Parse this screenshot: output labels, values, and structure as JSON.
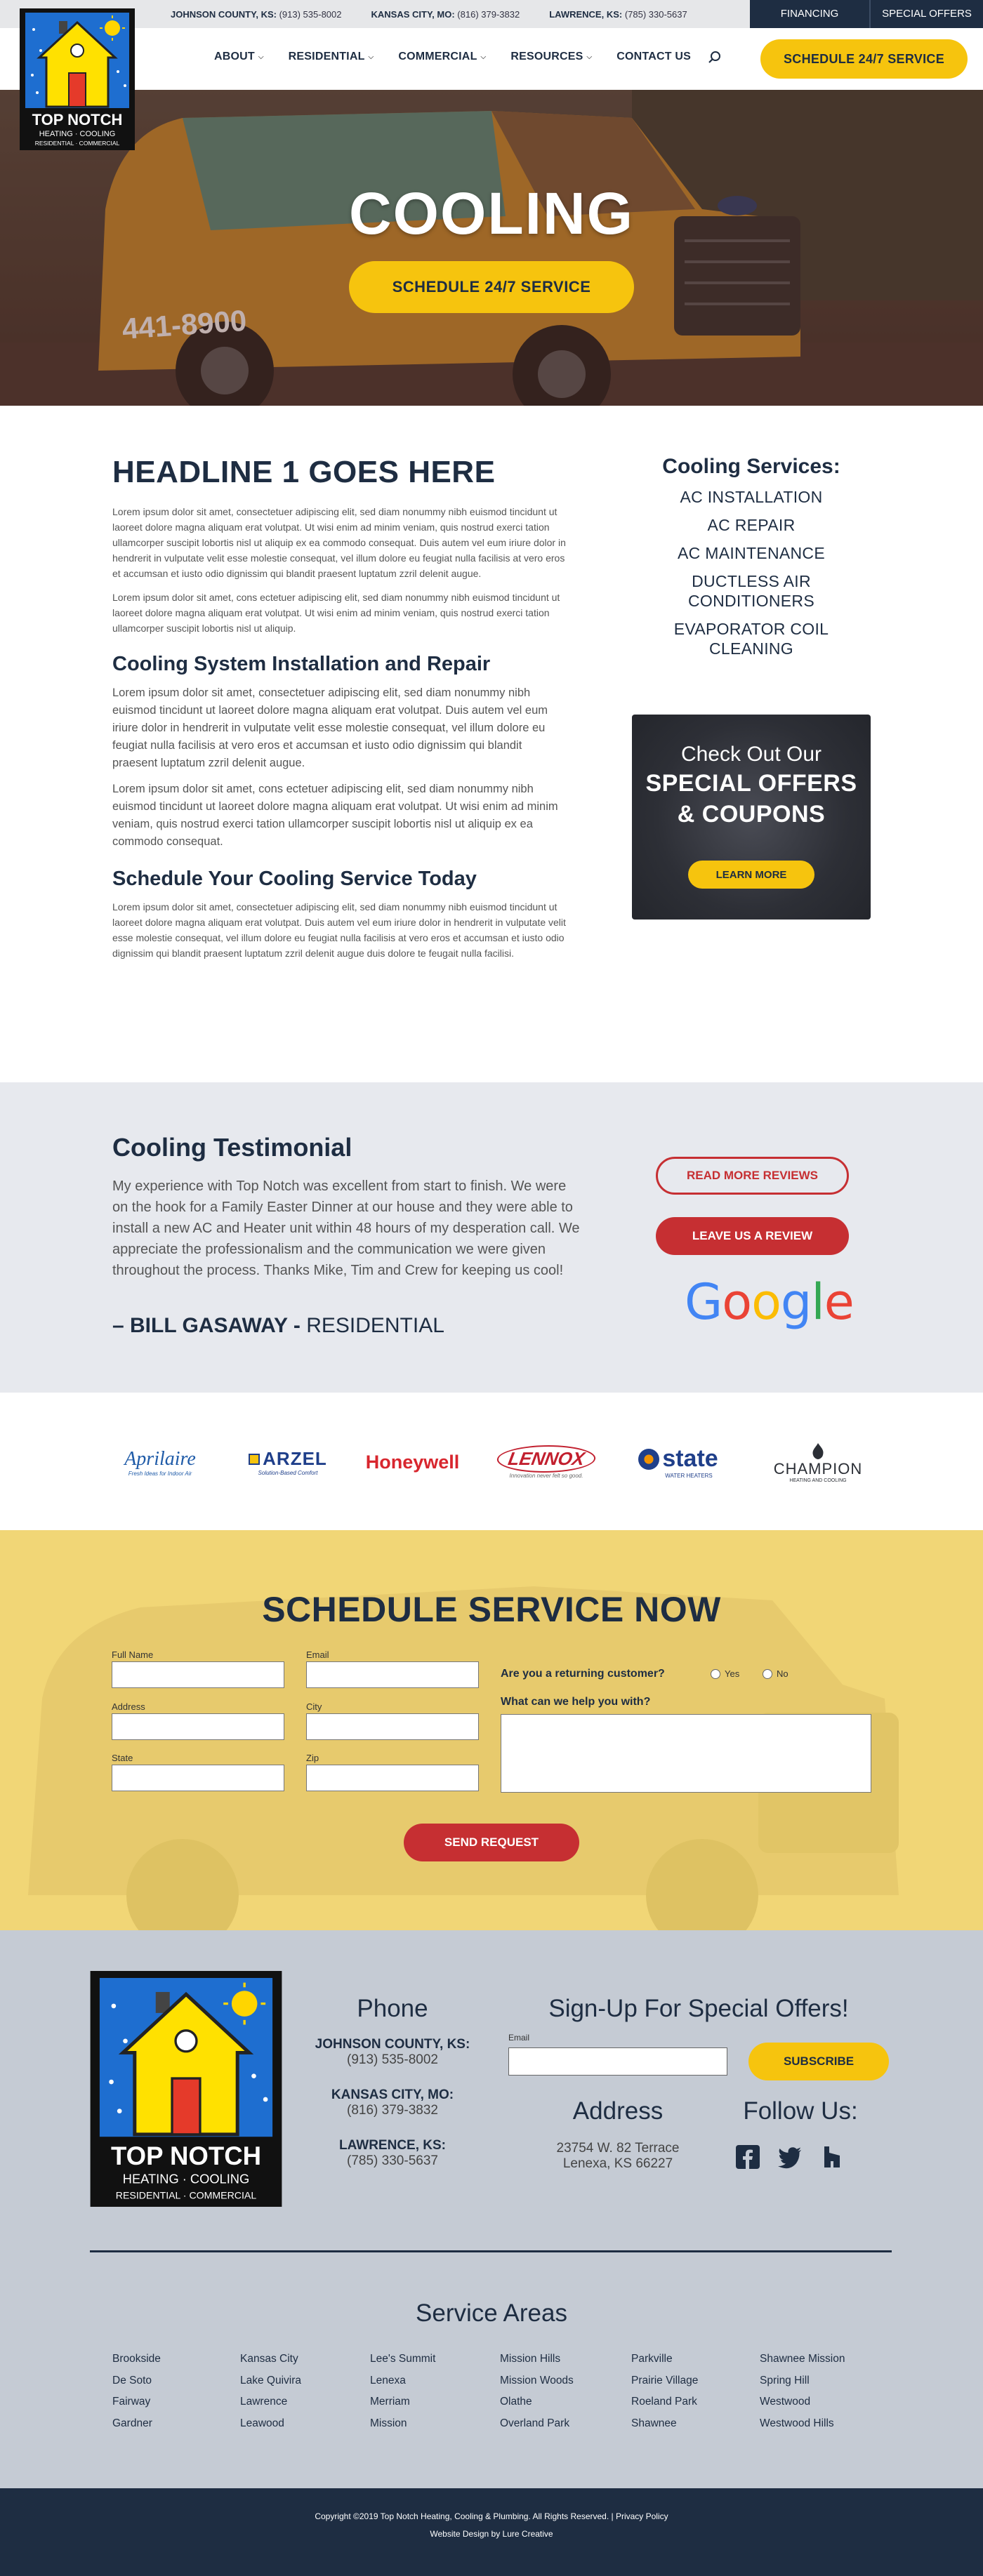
{
  "header": {
    "phones": [
      {
        "label": "JOHNSON COUNTY, KS:",
        "number": "(913) 535-8002"
      },
      {
        "label": "KANSAS CITY, MO:",
        "number": "(816) 379-3832"
      },
      {
        "label": "LAWRENCE, KS:",
        "number": "(785) 330-5637"
      }
    ],
    "financing_label": "FINANCING",
    "special_offers_label": "SPECIAL OFFERS",
    "nav": [
      {
        "label": "ABOUT",
        "dropdown": true
      },
      {
        "label": "RESIDENTIAL",
        "dropdown": true
      },
      {
        "label": "COMMERCIAL",
        "dropdown": true
      },
      {
        "label": "RESOURCES",
        "dropdown": true
      },
      {
        "label": "CONTACT US",
        "dropdown": false
      }
    ],
    "schedule_label": "SCHEDULE 24/7 SERVICE"
  },
  "logo": {
    "name": "TOP NOTCH",
    "line2": "HEATING · COOLING",
    "line3": "RESIDENTIAL · COMMERCIAL"
  },
  "hero": {
    "title": "COOLING",
    "button_label": "SCHEDULE 24/7 SERVICE",
    "van_phone": "441-8900"
  },
  "main": {
    "headline": "HEADLINE 1 GOES HERE",
    "p1": "Lorem ipsum dolor sit amet, consectetuer adipiscing elit, sed diam nonummy nibh euismod tincidunt ut laoreet dolore magna aliquam erat volutpat. Ut wisi enim ad minim veniam, quis nostrud exerci tation ullamcorper suscipit lobortis nisl ut aliquip ex ea commodo consequat. Duis autem vel eum iriure dolor in hendrerit in vulputate velit esse molestie consequat, vel illum dolore eu feugiat nulla facilisis at vero eros et accumsan et iusto odio dignissim qui blandit praesent luptatum zzril delenit augue.",
    "p2": "Lorem ipsum dolor sit amet, cons ectetuer adipiscing elit, sed diam nonummy nibh euismod tincidunt ut laoreet dolore magna aliquam erat volutpat. Ut wisi enim ad minim veniam, quis nostrud exerci tation ullamcorper suscipit lobortis nisl ut aliquip.",
    "h2a": "Cooling System Installation and Repair",
    "p3": "Lorem ipsum dolor sit amet, consectetuer adipiscing elit, sed diam nonummy nibh euismod tincidunt ut laoreet dolore magna aliquam erat volutpat. Duis autem vel eum iriure dolor in hendrerit in vulputate velit esse molestie consequat, vel illum dolore eu feugiat nulla facilisis at vero eros et accumsan et iusto odio dignissim qui blandit praesent luptatum zzril delenit augue.",
    "p4": "Lorem ipsum dolor sit amet, cons ectetuer adipiscing elit, sed diam nonummy nibh euismod tincidunt ut laoreet dolore magna aliquam erat volutpat. Ut wisi enim ad minim veniam, quis nostrud exerci tation ullamcorper suscipit lobortis nisl ut aliquip ex ea commodo consequat.",
    "h2b": "Schedule Your Cooling Service Today",
    "p5": "Lorem ipsum dolor sit amet, consectetuer adipiscing elit, sed diam nonummy nibh euismod tincidunt ut laoreet dolore magna aliquam erat volutpat. Duis autem vel eum iriure dolor in hendrerit in vulputate velit esse molestie consequat, vel illum dolore eu feugiat nulla facilisis at vero eros et accumsan et iusto odio dignissim qui blandit praesent luptatum zzril delenit augue duis dolore te feugait nulla facilisi."
  },
  "services": {
    "title": "Cooling Services:",
    "items": [
      "AC INSTALLATION",
      "AC REPAIR",
      "AC MAINTENANCE",
      "DUCTLESS AIR CONDITIONERS",
      "EVAPORATOR COIL CLEANING"
    ]
  },
  "offer": {
    "line1": "Check Out Our",
    "line2": "SPECIAL OFFERS",
    "line3": "& COUPONS",
    "button_label": "LEARN MORE"
  },
  "testimonial": {
    "title": "Cooling Testimonial",
    "quote": "My experience with Top Notch was excellent from start to finish. We were on the hook for a Family Easter Dinner at our house and they were able to install a new AC and Heater unit within 48 hours of my desperation call. We appreciate the professionalism and the communication we were given throughout the process. Thanks Mike, Tim and Crew for keeping us cool!",
    "author": "– BILL GASAWAY -",
    "author_type": " RESIDENTIAL",
    "read_more_label": "READ MORE REVIEWS",
    "leave_review_label": "LEAVE US A REVIEW",
    "google": [
      "G",
      "o",
      "o",
      "g",
      "l",
      "e"
    ]
  },
  "brands": [
    {
      "name": "Aprilaire",
      "tagline": "Fresh Ideas for Indoor Air"
    },
    {
      "name": "ARZEL",
      "tagline": "Solution-Based Comfort"
    },
    {
      "name": "Honeywell",
      "tagline": ""
    },
    {
      "name": "LENNOX",
      "tagline": "Innovation never felt so good."
    },
    {
      "name": "state",
      "tagline": "WATER HEATERS"
    },
    {
      "name": "CHAMPION",
      "tagline": "HEATING AND COOLING"
    }
  ],
  "form": {
    "title": "SCHEDULE SERVICE NOW",
    "labels": {
      "full_name": "Full Name",
      "email": "Email",
      "address": "Address",
      "city": "City",
      "state": "State",
      "zip": "Zip"
    },
    "returning_question": "Are you a returning customer?",
    "yes": "Yes",
    "no": "No",
    "help_question": "What can we help you with?",
    "send_label": "SEND REQUEST"
  },
  "footer": {
    "phone_title": "Phone",
    "phones": [
      {
        "label": "JOHNSON COUNTY, KS:",
        "number": "(913) 535-8002"
      },
      {
        "label": "KANSAS CITY, MO:",
        "number": "(816) 379-3832"
      },
      {
        "label": "LAWRENCE, KS:",
        "number": "(785) 330-5637"
      }
    ],
    "signup_title": "Sign-Up For Special Offers!",
    "email_label": "Email",
    "subscribe_label": "SUBSCRIBE",
    "address_title": "Address",
    "address_line1": "23754 W. 82 Terrace",
    "address_line2": "Lenexa, KS 66227",
    "follow_title": "Follow Us:",
    "social": [
      "facebook-icon",
      "twitter-icon",
      "houzz-icon"
    ],
    "service_areas_title": "Service Areas",
    "service_areas": [
      [
        "Brookside",
        "De Soto",
        "Fairway",
        "Gardner"
      ],
      [
        "Kansas City",
        "Lake Quivira",
        "Lawrence",
        "Leawood"
      ],
      [
        "Lee's Summit",
        "Lenexa",
        "Merriam",
        "Mission"
      ],
      [
        "Mission Hills",
        "Mission Woods",
        "Olathe",
        "Overland Park"
      ],
      [
        "Parkville",
        "Prairie Village",
        "Roeland Park",
        "Shawnee"
      ],
      [
        "Shawnee Mission",
        "Spring Hill",
        "Westwood",
        "Westwood Hills"
      ]
    ],
    "copyright": "Copyright ©2019 Top Notch Heating, Cooling & Plumbing. All Rights Reserved. | Privacy Policy",
    "credit": "Website Design by Lure Creative"
  },
  "colors": {
    "navy": "#1e2d42",
    "yellow": "#f6c40e",
    "red": "#c62f32",
    "footer_bg": "#c5cbd4",
    "testimonial_bg": "#e7e9ee"
  }
}
